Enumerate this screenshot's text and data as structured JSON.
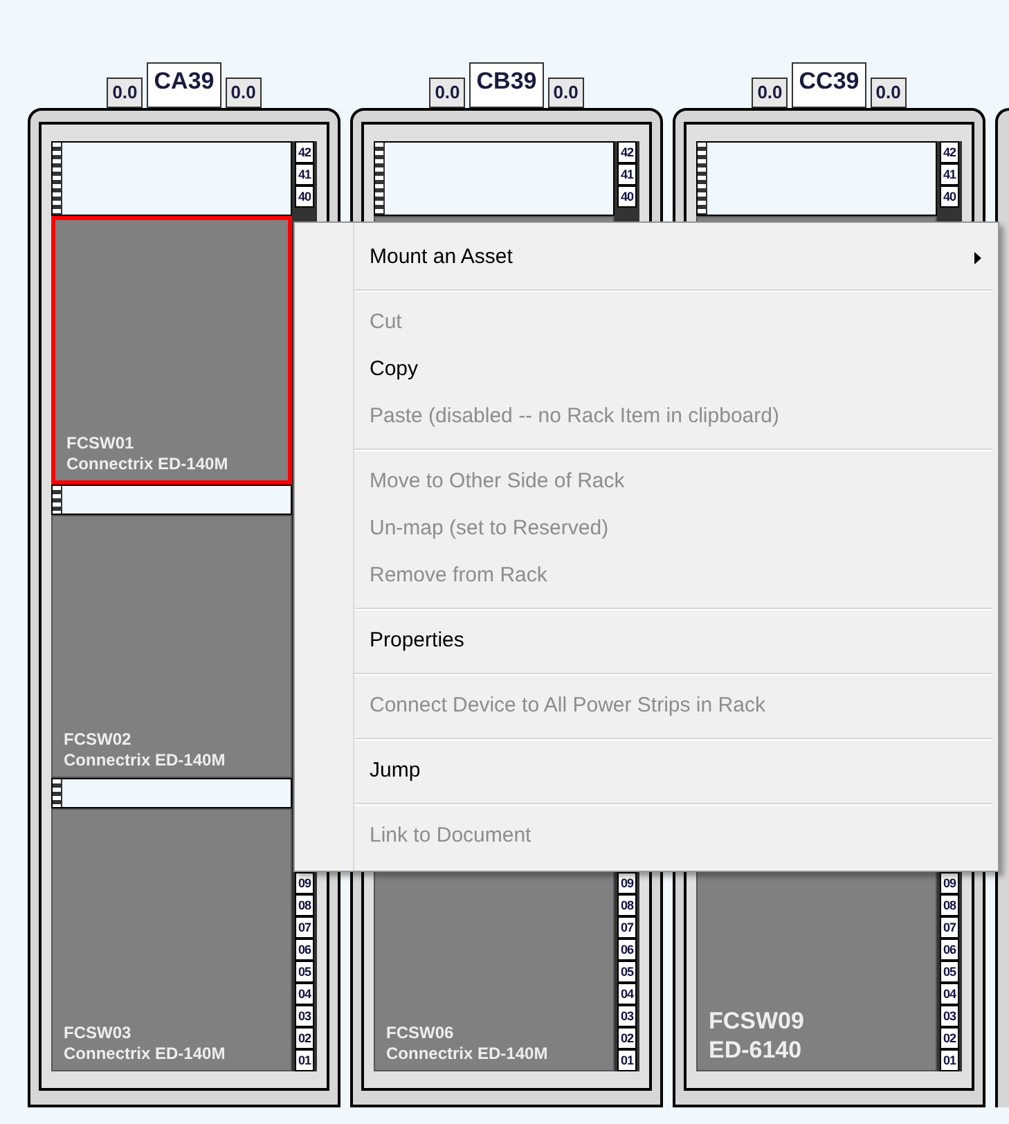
{
  "racks": [
    {
      "name": "CA39",
      "left_reading": "0.0",
      "right_reading": "0.0",
      "top_units": [
        "42",
        "41",
        "40"
      ],
      "bottom_units": [
        "09",
        "08",
        "07",
        "06",
        "05",
        "04",
        "03",
        "02",
        "01"
      ],
      "items": [
        {
          "kind": "empty"
        },
        {
          "kind": "device",
          "name": "FCSW01",
          "model": "Connectrix ED-140M",
          "selected": true,
          "large": false
        },
        {
          "kind": "empty"
        },
        {
          "kind": "device",
          "name": "FCSW02",
          "model": "Connectrix ED-140M",
          "selected": false,
          "large": false
        },
        {
          "kind": "empty"
        },
        {
          "kind": "device",
          "name": "FCSW03",
          "model": "Connectrix ED-140M",
          "selected": false,
          "large": false
        }
      ]
    },
    {
      "name": "CB39",
      "left_reading": "0.0",
      "right_reading": "0.0",
      "top_units": [
        "42",
        "41",
        "40"
      ],
      "bottom_units": [
        "09",
        "08",
        "07",
        "06",
        "05",
        "04",
        "03",
        "02",
        "01"
      ],
      "items": [
        {
          "kind": "empty"
        },
        {
          "kind": "device",
          "name": "FCSW06",
          "model": "Connectrix ED-140M",
          "selected": false,
          "large": false
        }
      ]
    },
    {
      "name": "CC39",
      "left_reading": "0.0",
      "right_reading": "0.0",
      "top_units": [
        "42",
        "41",
        "40"
      ],
      "bottom_units": [
        "09",
        "08",
        "07",
        "06",
        "05",
        "04",
        "03",
        "02",
        "01"
      ],
      "items": [
        {
          "kind": "empty"
        },
        {
          "kind": "device",
          "name": "FCSW09",
          "model": "ED-6140",
          "selected": false,
          "large": true
        }
      ]
    }
  ],
  "context_menu": {
    "items": [
      {
        "kind": "item",
        "label": "Mount an Asset",
        "disabled": false,
        "submenu": true
      },
      {
        "kind": "separator"
      },
      {
        "kind": "item",
        "label": "Cut",
        "disabled": true,
        "submenu": false
      },
      {
        "kind": "item",
        "label": "Copy",
        "disabled": false,
        "submenu": false
      },
      {
        "kind": "item",
        "label": "Paste (disabled -- no Rack Item in clipboard)",
        "disabled": true,
        "submenu": false
      },
      {
        "kind": "separator"
      },
      {
        "kind": "item",
        "label": "Move to Other Side of Rack",
        "disabled": true,
        "submenu": false
      },
      {
        "kind": "item",
        "label": "Un-map (set to Reserved)",
        "disabled": true,
        "submenu": false
      },
      {
        "kind": "item",
        "label": "Remove from Rack",
        "disabled": true,
        "submenu": false
      },
      {
        "kind": "separator"
      },
      {
        "kind": "item",
        "label": "Properties",
        "disabled": false,
        "submenu": false
      },
      {
        "kind": "separator"
      },
      {
        "kind": "item",
        "label": "Connect Device to All Power Strips in Rack",
        "disabled": true,
        "submenu": false
      },
      {
        "kind": "separator"
      },
      {
        "kind": "item",
        "label": "Jump",
        "disabled": false,
        "submenu": false
      },
      {
        "kind": "separator"
      },
      {
        "kind": "item",
        "label": "Link to Document",
        "disabled": true,
        "submenu": false
      }
    ]
  }
}
